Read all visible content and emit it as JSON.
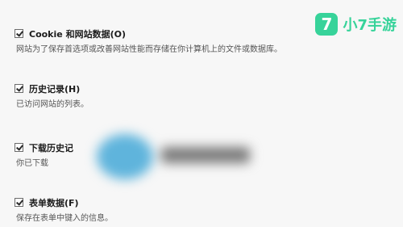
{
  "options": [
    {
      "label": "Cookie 和网站数据(O)",
      "desc": "网站为了保存首选项或改善网站性能而存储在你计算机上的文件或数据库。",
      "checked": true
    },
    {
      "label": "历史记录(H)",
      "desc": "已访问网站的列表。",
      "checked": true
    },
    {
      "label": "下载历史记",
      "desc": "你已下载",
      "checked": true
    },
    {
      "label": "表单数据(F)",
      "desc": "保存在表单中键入的信息。",
      "checked": true
    }
  ],
  "logo": {
    "badge": "7",
    "text": "小7手游",
    "color": "#37d39a"
  }
}
